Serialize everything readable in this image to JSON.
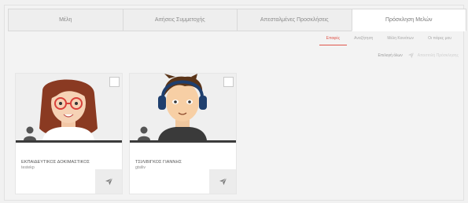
{
  "tabs": [
    {
      "label": "Μέλη"
    },
    {
      "label": "Αιτήσεις Συμμετοχής"
    },
    {
      "label": "Απεσταλμένες Προσκλήσεις"
    },
    {
      "label": "Πρόσκληση Μελών"
    }
  ],
  "active_tab": 3,
  "subtabs": [
    {
      "label": "Επαφές"
    },
    {
      "label": "Αναζήτηση"
    },
    {
      "label": "Μέλη Κοινότων"
    },
    {
      "label": "Οι πάρες μου"
    }
  ],
  "active_subtab": 0,
  "actions": {
    "select_all": "Επιλογή όλων",
    "send_invitation": "Αποστολή Πρόσκλησης"
  },
  "contacts": [
    {
      "name": "ΕΚΠΑΙΔΕΥΤΙΚΟΣ ΔΟΚΙΜΑΣΤΙΚΟΣ",
      "username": "testekp",
      "avatar": "female-teacher-avatar"
    },
    {
      "name": "ΤΣΙΛΙΒΙΓΚΟΣ ΓΙΑΝΝΗΣ",
      "username": "gtsiliv",
      "avatar": "male-headphones-avatar"
    }
  ],
  "colors": {
    "accent": "#e0554b",
    "background": "#f1f1f1",
    "card": "#ffffff"
  }
}
